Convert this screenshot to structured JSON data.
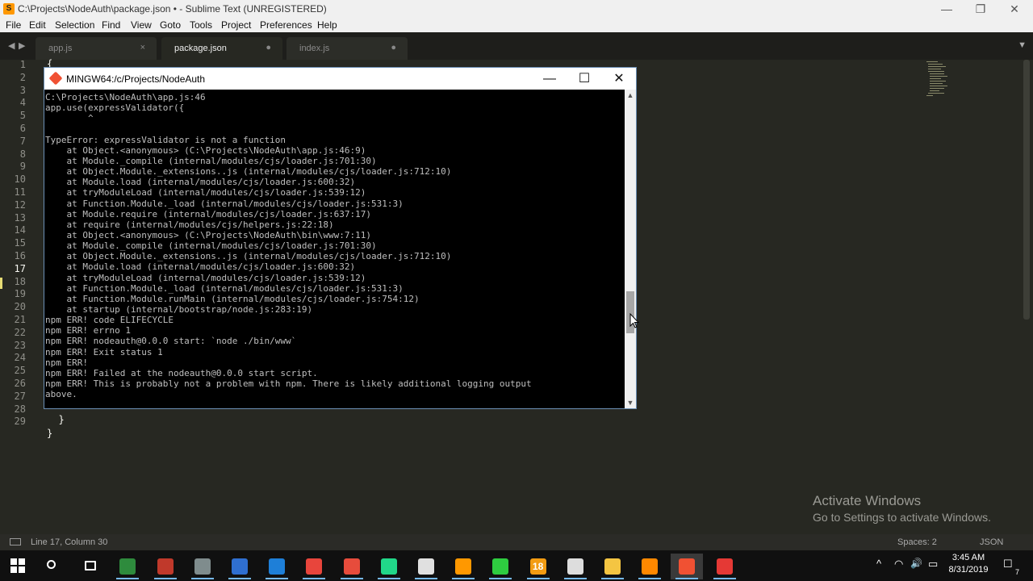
{
  "window": {
    "title": "C:\\Projects\\NodeAuth\\package.json • - Sublime Text (UNREGISTERED)",
    "minimize_glyph": "—",
    "maximize_glyph": "❐",
    "close_glyph": "✕"
  },
  "menu": [
    "File",
    "Edit",
    "Selection",
    "Find",
    "View",
    "Goto",
    "Tools",
    "Project",
    "Preferences",
    "Help"
  ],
  "tabs": [
    {
      "label": "app.js",
      "close_glyph": "×"
    },
    {
      "label": "package.json",
      "close_glyph": "●"
    },
    {
      "label": "index.js",
      "close_glyph": "●"
    }
  ],
  "tab_nav": {
    "back": "◀",
    "forward": "▶",
    "menu": "▼"
  },
  "gutter": {
    "line_numbers": [
      "1",
      "2",
      "3",
      "4",
      "5",
      "6",
      "7",
      "8",
      "9",
      "10",
      "11",
      "12",
      "13",
      "14",
      "15",
      "16",
      "17",
      "18",
      "19",
      "20",
      "21",
      "22",
      "23",
      "24",
      "25",
      "26",
      "27",
      "28",
      "29"
    ],
    "active_line": "17"
  },
  "editor_visible_code": [
    {
      "line": "1",
      "text": "{"
    },
    {
      "line": "27",
      "text": "  }"
    },
    {
      "line": "28",
      "text": "}"
    }
  ],
  "terminal": {
    "title": "MINGW64:/c/Projects/NodeAuth",
    "lines": [
      "C:\\Projects\\NodeAuth\\app.js:46",
      "app.use(expressValidator({",
      "        ^",
      "",
      "TypeError: expressValidator is not a function",
      "    at Object.<anonymous> (C:\\Projects\\NodeAuth\\app.js:46:9)",
      "    at Module._compile (internal/modules/cjs/loader.js:701:30)",
      "    at Object.Module._extensions..js (internal/modules/cjs/loader.js:712:10)",
      "    at Module.load (internal/modules/cjs/loader.js:600:32)",
      "    at tryModuleLoad (internal/modules/cjs/loader.js:539:12)",
      "    at Function.Module._load (internal/modules/cjs/loader.js:531:3)",
      "    at Module.require (internal/modules/cjs/loader.js:637:17)",
      "    at require (internal/modules/cjs/helpers.js:22:18)",
      "    at Object.<anonymous> (C:\\Projects\\NodeAuth\\bin\\www:7:11)",
      "    at Module._compile (internal/modules/cjs/loader.js:701:30)",
      "    at Object.Module._extensions..js (internal/modules/cjs/loader.js:712:10)",
      "    at Module.load (internal/modules/cjs/loader.js:600:32)",
      "    at tryModuleLoad (internal/modules/cjs/loader.js:539:12)",
      "    at Function.Module._load (internal/modules/cjs/loader.js:531:3)",
      "    at Function.Module.runMain (internal/modules/cjs/loader.js:754:12)",
      "    at startup (internal/bootstrap/node.js:283:19)",
      "npm ERR! code ELIFECYCLE",
      "npm ERR! errno 1",
      "npm ERR! nodeauth@0.0.0 start: `node ./bin/www`",
      "npm ERR! Exit status 1",
      "npm ERR!",
      "npm ERR! Failed at the nodeauth@0.0.0 start script.",
      "npm ERR! This is probably not a problem with npm. There is likely additional logging output",
      "above."
    ],
    "scroll_up": "▲",
    "scroll_down": "▼"
  },
  "watermark": {
    "line1": "Activate Windows",
    "line2": "Go to Settings to activate Windows."
  },
  "status_bar": {
    "position": "Line 17, Column 30",
    "spaces": "Spaces: 2",
    "syntax": "JSON"
  },
  "taskbar": {
    "apps": [
      {
        "name": "search-icon",
        "color": "#ffffff"
      },
      {
        "name": "task-view-icon",
        "color": "#ffffff"
      },
      {
        "name": "spreadsheet-app-icon",
        "color": "#2e8b3d"
      },
      {
        "name": "app-icon-bubble",
        "color": "#c0392b"
      },
      {
        "name": "app-icon-settings",
        "color": "#7f8c8d"
      },
      {
        "name": "app-icon-blue",
        "color": "#2f6fd1"
      },
      {
        "name": "edge-icon",
        "color": "#1e7fd8"
      },
      {
        "name": "chrome-icon",
        "color": "#e8453c"
      },
      {
        "name": "windows-store-icon",
        "color": "#e74c3c"
      },
      {
        "name": "pycharm-icon",
        "color": "#21d789"
      },
      {
        "name": "file-icon",
        "color": "#e0e0e0"
      },
      {
        "name": "sublime-text-icon",
        "color": "#ff9800"
      },
      {
        "name": "camtasia-icon",
        "color": "#2ecc40"
      },
      {
        "name": "app-icon-18",
        "color": "#f39c12",
        "label": "18"
      },
      {
        "name": "inkscape-icon",
        "color": "#dddddd"
      },
      {
        "name": "file-explorer-icon",
        "color": "#f4c542"
      },
      {
        "name": "vlc-icon",
        "color": "#ff8800"
      },
      {
        "name": "git-bash-icon",
        "color": "#f05133"
      },
      {
        "name": "app-icon-red-c",
        "color": "#e53935"
      }
    ],
    "tray_glyphs": {
      "chevron": "^",
      "wifi": "◠",
      "volume": "🔊",
      "battery": "▭",
      "notification": "☐"
    },
    "time": "3:45 AM",
    "date": "8/31/2019",
    "notification_count": "7"
  }
}
